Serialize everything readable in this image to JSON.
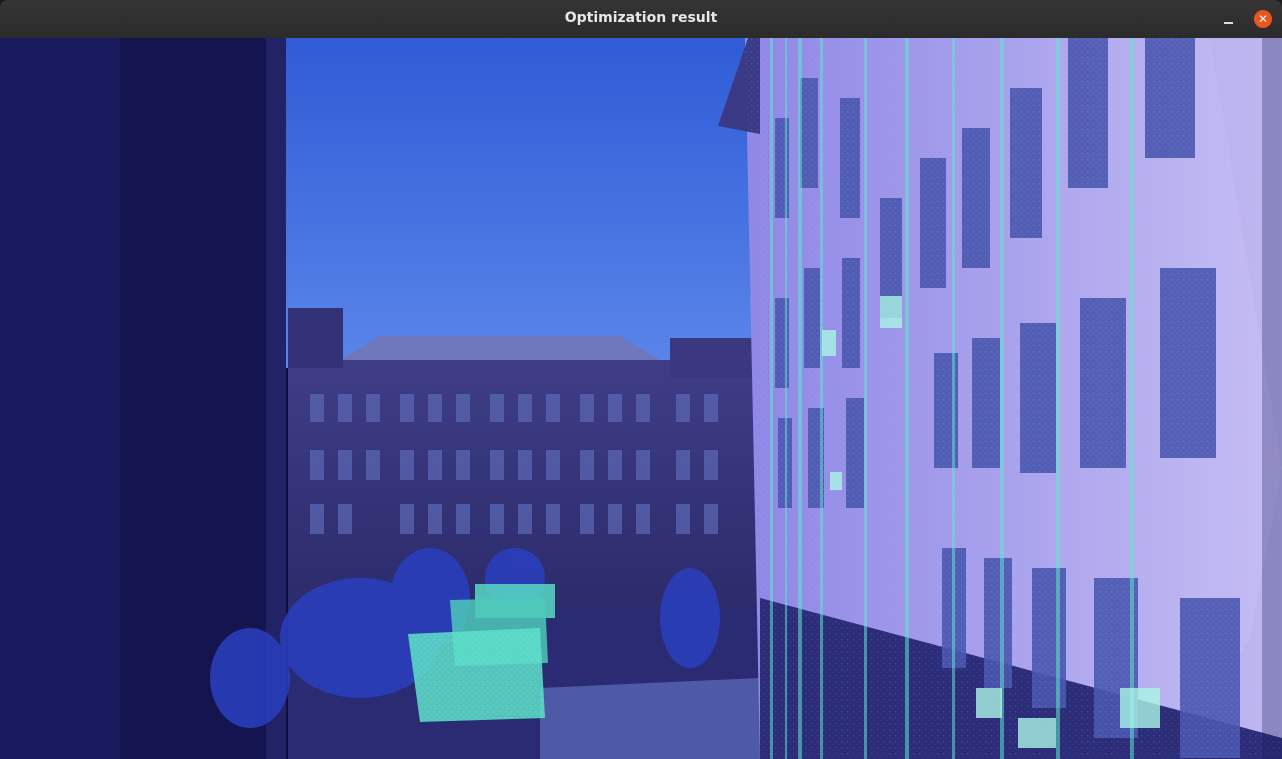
{
  "window": {
    "title": "Optimization result",
    "close_glyph": "✕",
    "minimize_icon": "minimize-icon",
    "close_icon": "close-icon"
  },
  "image_view": {
    "content": "lidar-camera overlay image",
    "colors": {
      "sky": "#3e6ce3",
      "frame": "#111147",
      "facade": "#b3a8ee",
      "points": "#5fe6cf"
    }
  }
}
